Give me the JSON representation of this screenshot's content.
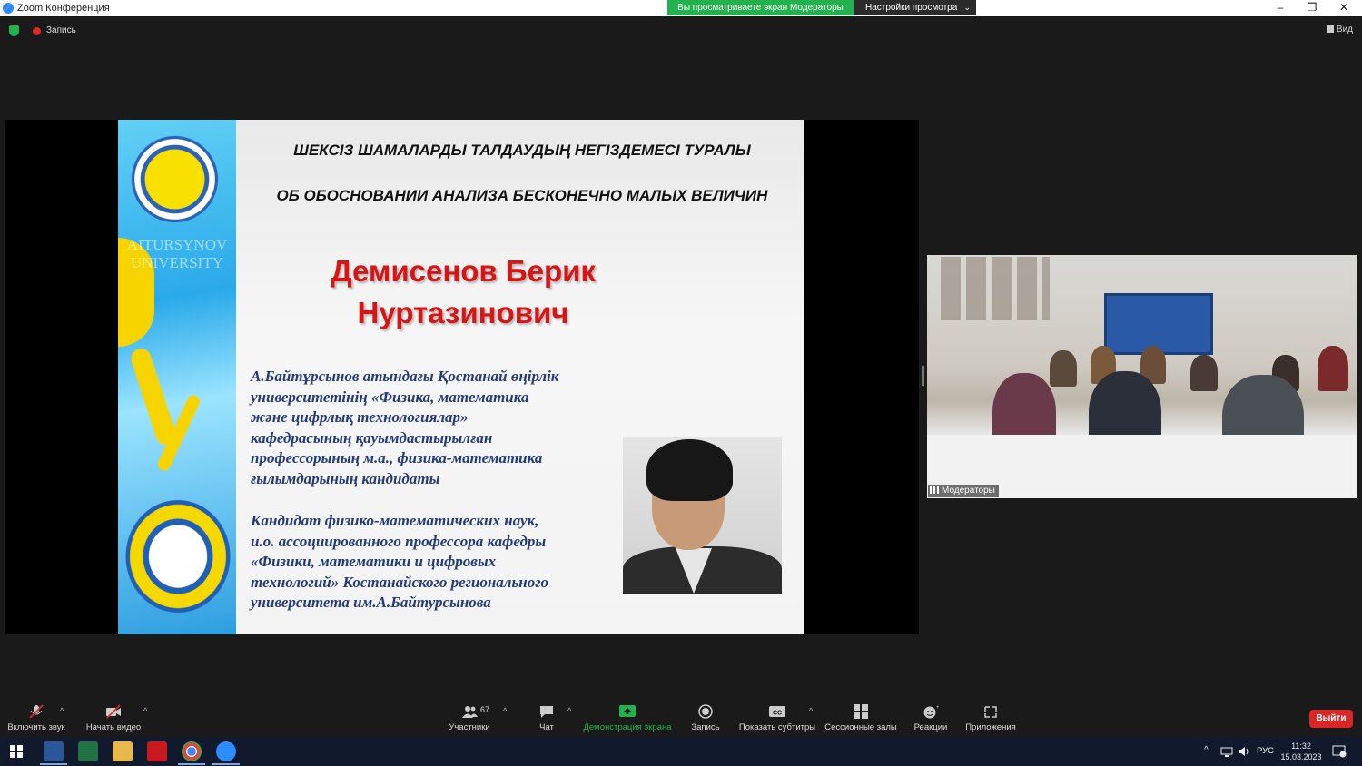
{
  "window": {
    "title": "Zoom Конференция",
    "share_banner": "Вы просматриваете экран Модераторы",
    "view_settings": "Настройки просмотра"
  },
  "meeting": {
    "record_label": "Запись",
    "view_label": "Вид"
  },
  "slide": {
    "title_kz": "ШЕКСІЗ ШАМАЛАРДЫ ТАЛДАУДЫҢ НЕГІЗДЕМЕСІ ТУРАЛЫ",
    "title_ru": "ОБ ОБОСНОВАНИИ АНАЛИЗА БЕСКОНЕЧНО МАЛЫХ ВЕЛИЧИН",
    "author_line1": "Демисенов Берик",
    "author_line2": "Нуртазинович",
    "band_text": "AITURSYNOV UNIVERSITY",
    "desc_kz": "А.Байтұрсынов атындағы Қостанай өңірлік\nуниверситетінің «Физика, математика\nжәне цифрлық технологиялар»\nкафедрасының қауымдастырылған\nпрофессорының м.а., физика-математика\nғылымдарының кандидаты",
    "desc_ru": "Кандидат физико-математических наук,\nи.о. ассоциированного профессора кафедры\n«Физики, математики и цифровых\nтехнологий» Костанайского регионального\nуниверситета им.А.Байтурсынова"
  },
  "video": {
    "participant_name": "Модераторы"
  },
  "toolbar": {
    "unmute": "Включить звук",
    "start_video": "Начать видео",
    "participants": "Участники",
    "participants_count": "67",
    "chat": "Чат",
    "share_screen": "Демонстрация экрана",
    "record": "Запись",
    "captions": "Показать субтитры",
    "breakout": "Сессионные залы",
    "reactions": "Реакции",
    "apps": "Приложения",
    "leave": "Выйти"
  },
  "taskbar": {
    "language": "РУС",
    "time": "11:32",
    "date": "15.03.2023"
  },
  "colors": {
    "share_green": "#23b14d",
    "leave_red": "#d92626",
    "author_red": "#d91414",
    "desc_blue": "#243a7a"
  }
}
